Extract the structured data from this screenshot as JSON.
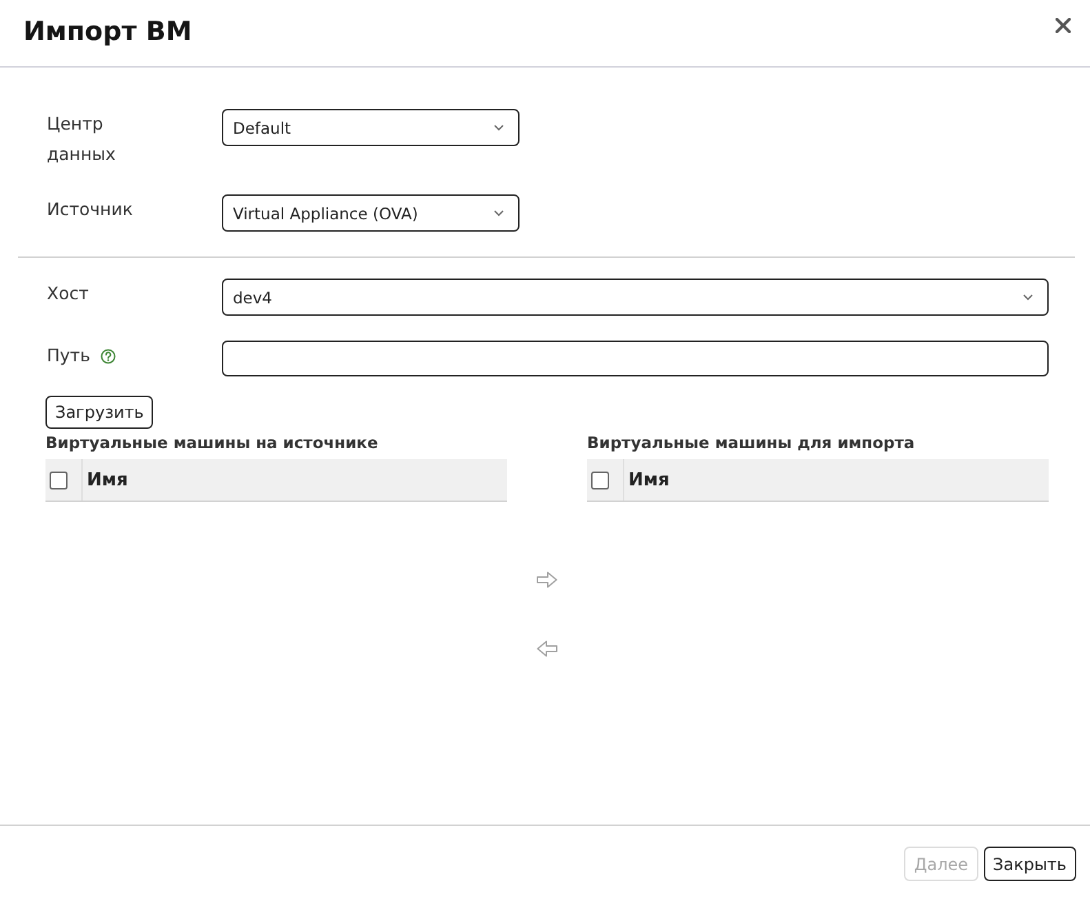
{
  "dialog": {
    "title": "Импорт ВМ"
  },
  "sections": [
    {
      "fields": [
        {
          "kind": "select",
          "label": "Центр данных",
          "value": "Default"
        },
        {
          "kind": "select",
          "label": "Источник",
          "value": "Virtual Appliance (OVA)"
        }
      ]
    },
    {
      "fields": [
        {
          "kind": "select",
          "label": "Хост",
          "value": "dev4"
        },
        {
          "kind": "text",
          "label": "Путь",
          "help": true
        }
      ]
    }
  ],
  "load_button": {
    "label": "Загрузить"
  },
  "vm_lists": [
    {
      "title": "Виртуальные машины на источнике",
      "select_all_checked": false,
      "columns": [
        "Имя"
      ]
    },
    {
      "title": "Виртуальные машины для импорта",
      "select_all_checked": false,
      "columns": [
        "Имя"
      ]
    }
  ],
  "footer_buttons": [
    {
      "label": "Далее",
      "disabled": true
    },
    {
      "label": "Закрыть",
      "disabled": false
    }
  ]
}
